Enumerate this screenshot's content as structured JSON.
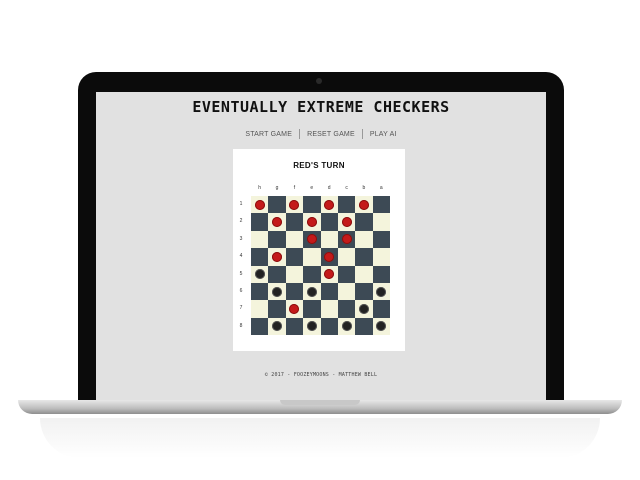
{
  "site": {
    "title": "Eventually Extreme Checkers",
    "footer": "© 2017 - Foozeymoons - Matthew Bell"
  },
  "nav": {
    "items": [
      "Start Game",
      "Reset Game",
      "Play AI"
    ]
  },
  "game": {
    "turn_label": "Red's Turn",
    "column_labels": [
      "h",
      "g",
      "f",
      "e",
      "d",
      "c",
      "b",
      "a"
    ],
    "row_labels": [
      "1",
      "2",
      "3",
      "4",
      "5",
      "6",
      "7",
      "8"
    ],
    "colors": {
      "light_square": "#f4f4dc",
      "dark_square": "#3d4a55",
      "red_piece": "#c41a1a",
      "black_piece": "#222222"
    },
    "board": [
      "R.R.R.R.",
      ".R.R.R..",
      "...R.R..",
      ".R..R...",
      "B...R...",
      ".B.B...B",
      "..R...B.",
      ".B.B.B.B"
    ]
  }
}
